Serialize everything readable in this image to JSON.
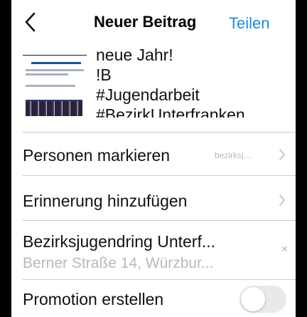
{
  "header": {
    "title": "Neuer Beitrag",
    "share_label": "Teilen",
    "accent_color": "#1c8ce8"
  },
  "post": {
    "thumbnail_icon": "post-image-thumbnail",
    "caption_lines": [
      "neue Jahr!",
      "!B",
      "#Jugendarbeit",
      "#BezirkUnterfranken"
    ]
  },
  "options": {
    "tag_people": {
      "label": "Personen markieren",
      "hint": "bezirksj..."
    },
    "reminder": {
      "label": "Erinnerung hinzufügen"
    },
    "location": {
      "name": "Bezirksjugendring Unterf...",
      "address": "Berner Straße 14, Würzbur..."
    },
    "promotion": {
      "label": "Promotion erstellen",
      "enabled": false
    }
  }
}
